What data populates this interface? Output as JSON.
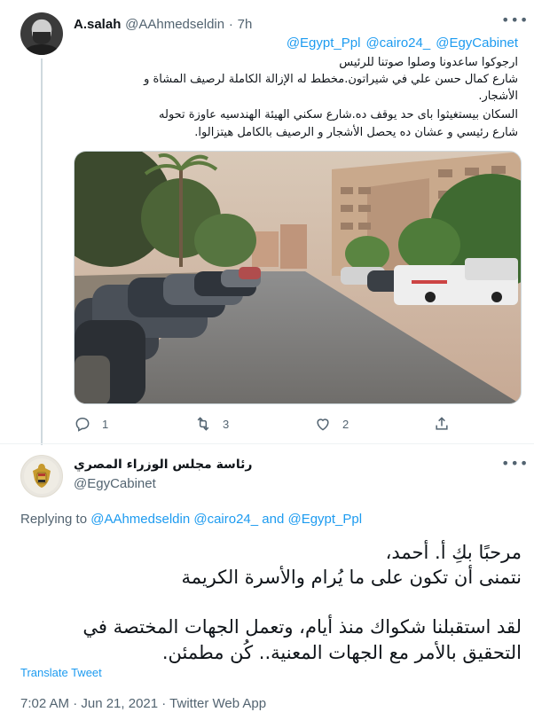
{
  "tweet1": {
    "author_name": "A.salah",
    "author_handle": "@AAhmedseldin",
    "separator": "·",
    "time": "7h",
    "mentions": [
      "@Egypt_Ppl",
      "@cairo24_",
      "@EgyCabinet"
    ],
    "lines": [
      "ارجوكوا ساعدونا وصلوا صوتنا للرئيس",
      "شارع كمال حسن علي في شيراتون.مخطط له الإزالة الكاملة لرصيف المشاة و",
      "الأشجار.",
      "السكان بيستغيثوا باى حد يوقف ده.شارع سكني الهيئة الهندسيه عاوزة تحوله",
      "شارع رئيسي و عشان ده يحصل الأشجار و الرصيف بالكامل هيتزالوا."
    ],
    "actions": {
      "reply_count": "1",
      "retweet_count": "3",
      "like_count": "2"
    }
  },
  "tweet2": {
    "author_name": "رئاسة مجلس الوزراء المصري",
    "author_handle": "@EgyCabinet",
    "replying_prefix": "Replying to",
    "replying_targets": "@AAhmedseldin @cairo24_ and @Egypt_Ppl",
    "lines": [
      "مرحبًا بكِ أ. أحمد،",
      "نتمنى أن تكون على ما يُرام والأسرة الكريمة",
      "لقد استقبلنا شكواك منذ أيام، وتعمل الجهات المختصة في",
      "التحقيق بالأمر مع الجهات المعنية.. كُن مطمئن."
    ],
    "translate_label": "Translate Tweet",
    "timestamp": "7:02 AM · Jun 21, 2021 · Twitter Web App"
  },
  "icons": {
    "more": "more-icon",
    "reply": "reply-icon",
    "retweet": "retweet-icon",
    "like": "like-icon",
    "share": "share-icon"
  },
  "colors": {
    "link": "#1d9bf0",
    "secondary_text": "#536471",
    "thread_line": "#cfd9de"
  }
}
